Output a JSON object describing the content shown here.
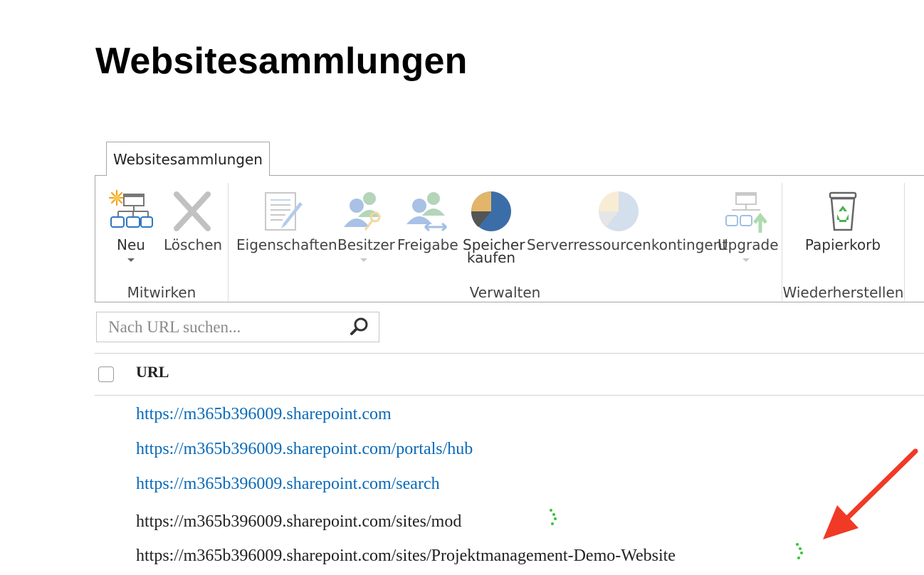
{
  "page": {
    "title": "Websitesammlungen"
  },
  "ribbon": {
    "tab_label": "Websitesammlungen",
    "groups": {
      "contribute": {
        "label": "Mitwirken",
        "new_label": "Neu",
        "delete_label": "Löschen"
      },
      "manage": {
        "label": "Verwalten",
        "properties_label": "Eigenschaften",
        "owners_label": "Besitzer",
        "sharing_label": "Freigabe",
        "buy_storage_line1": "Speicher",
        "buy_storage_line2": "kaufen",
        "server_quota_label": "Serverressourcenkontingent",
        "upgrade_label": "Upgrade"
      },
      "restore": {
        "label": "Wiederherstellen",
        "recycle_label": "Papierkorb"
      }
    }
  },
  "search": {
    "placeholder": "Nach URL suchen..."
  },
  "table": {
    "column_url": "URL",
    "rows": [
      {
        "url": "https://m365b396009.sharepoint.com",
        "link": true
      },
      {
        "url": "https://m365b396009.sharepoint.com/portals/hub",
        "link": true
      },
      {
        "url": "https://m365b396009.sharepoint.com/search",
        "link": true
      },
      {
        "url": "https://m365b396009.sharepoint.com/sites/mod",
        "link": false,
        "loading": true
      },
      {
        "url": "https://m365b396009.sharepoint.com/sites/Projektmanagement-Demo-Website",
        "link": false,
        "loading": true
      }
    ]
  },
  "colors": {
    "link": "#0a6ab8",
    "spinner": "#3cc43c",
    "annotation_arrow": "#f03a26"
  },
  "icons": [
    "new-site-icon",
    "delete-x-icon",
    "properties-icon",
    "owners-icon",
    "sharing-icon",
    "pie-chart-icon",
    "quota-pie-icon",
    "upgrade-icon",
    "recycle-bin-icon",
    "search-icon",
    "loading-spinner-icon",
    "red-arrow-annotation"
  ]
}
